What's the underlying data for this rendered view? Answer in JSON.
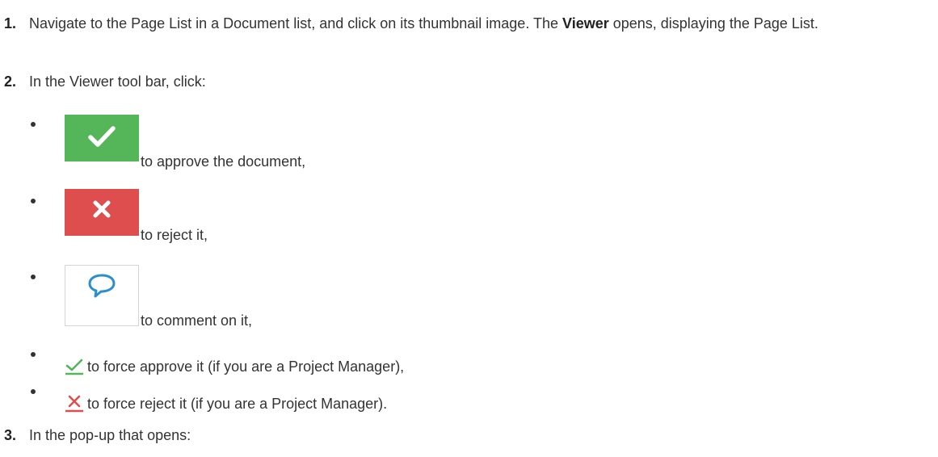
{
  "steps": [
    {
      "number": "1.",
      "text_before": "Navigate to the Page List in a Document list, and click on its thumbnail image. The ",
      "bold": "Viewer",
      "text_after": " opens, displaying the Page List."
    },
    {
      "number": "2.",
      "text": "In the Viewer tool bar, click:"
    },
    {
      "number": "3.",
      "text": "In the pop-up that opens:"
    }
  ],
  "toolbar_items": [
    {
      "icon": "approve-icon",
      "text": "to approve the document,",
      "color": "#55b559"
    },
    {
      "icon": "reject-icon",
      "text": "to reject it,",
      "color": "#de4e4e"
    },
    {
      "icon": "comment-icon",
      "text": "to comment on it,",
      "color": "#2b8fcf"
    },
    {
      "icon": "force-approve-icon",
      "text": "to force approve it (if you are a Project Manager),",
      "color": "#55b559"
    },
    {
      "icon": "force-reject-icon",
      "text": "to force reject it (if you are a Project Manager).",
      "color": "#de4e4e"
    }
  ]
}
